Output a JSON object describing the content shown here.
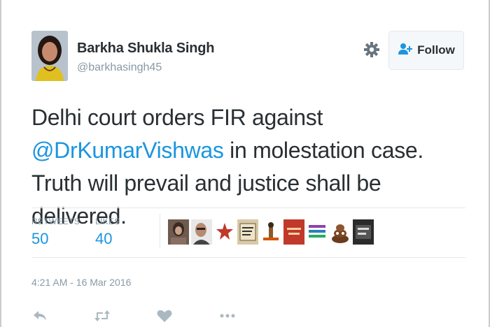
{
  "author": {
    "name": "Barkha Shukla Singh",
    "handle": "@barkhasingh45"
  },
  "follow_button": {
    "label": "Follow"
  },
  "tweet": {
    "text_before": "Delhi court orders FIR against",
    "mention": "@DrKumarVishwas",
    "text_after": " in molestation case. Truth will prevail and justice shall be delivered."
  },
  "stats": {
    "retweets_label": "RETWEETS",
    "retweets_count": "50",
    "likes_label": "LIKES",
    "likes_count": "40"
  },
  "likers": [
    {
      "name": "liker-avatar-1"
    },
    {
      "name": "liker-avatar-2"
    },
    {
      "name": "liker-avatar-3"
    },
    {
      "name": "liker-avatar-4"
    },
    {
      "name": "liker-avatar-5"
    },
    {
      "name": "liker-avatar-6"
    },
    {
      "name": "liker-avatar-7"
    },
    {
      "name": "liker-avatar-8"
    },
    {
      "name": "liker-avatar-9"
    }
  ],
  "timestamp": "4:21 AM - 16 Mar 2016",
  "actions": [
    "reply-icon",
    "retweet-icon",
    "like-icon",
    "more-icon"
  ],
  "colors": {
    "link": "#1b95e0",
    "muted": "#8899a6",
    "text": "#292f33",
    "divider": "#e1e8ed"
  }
}
